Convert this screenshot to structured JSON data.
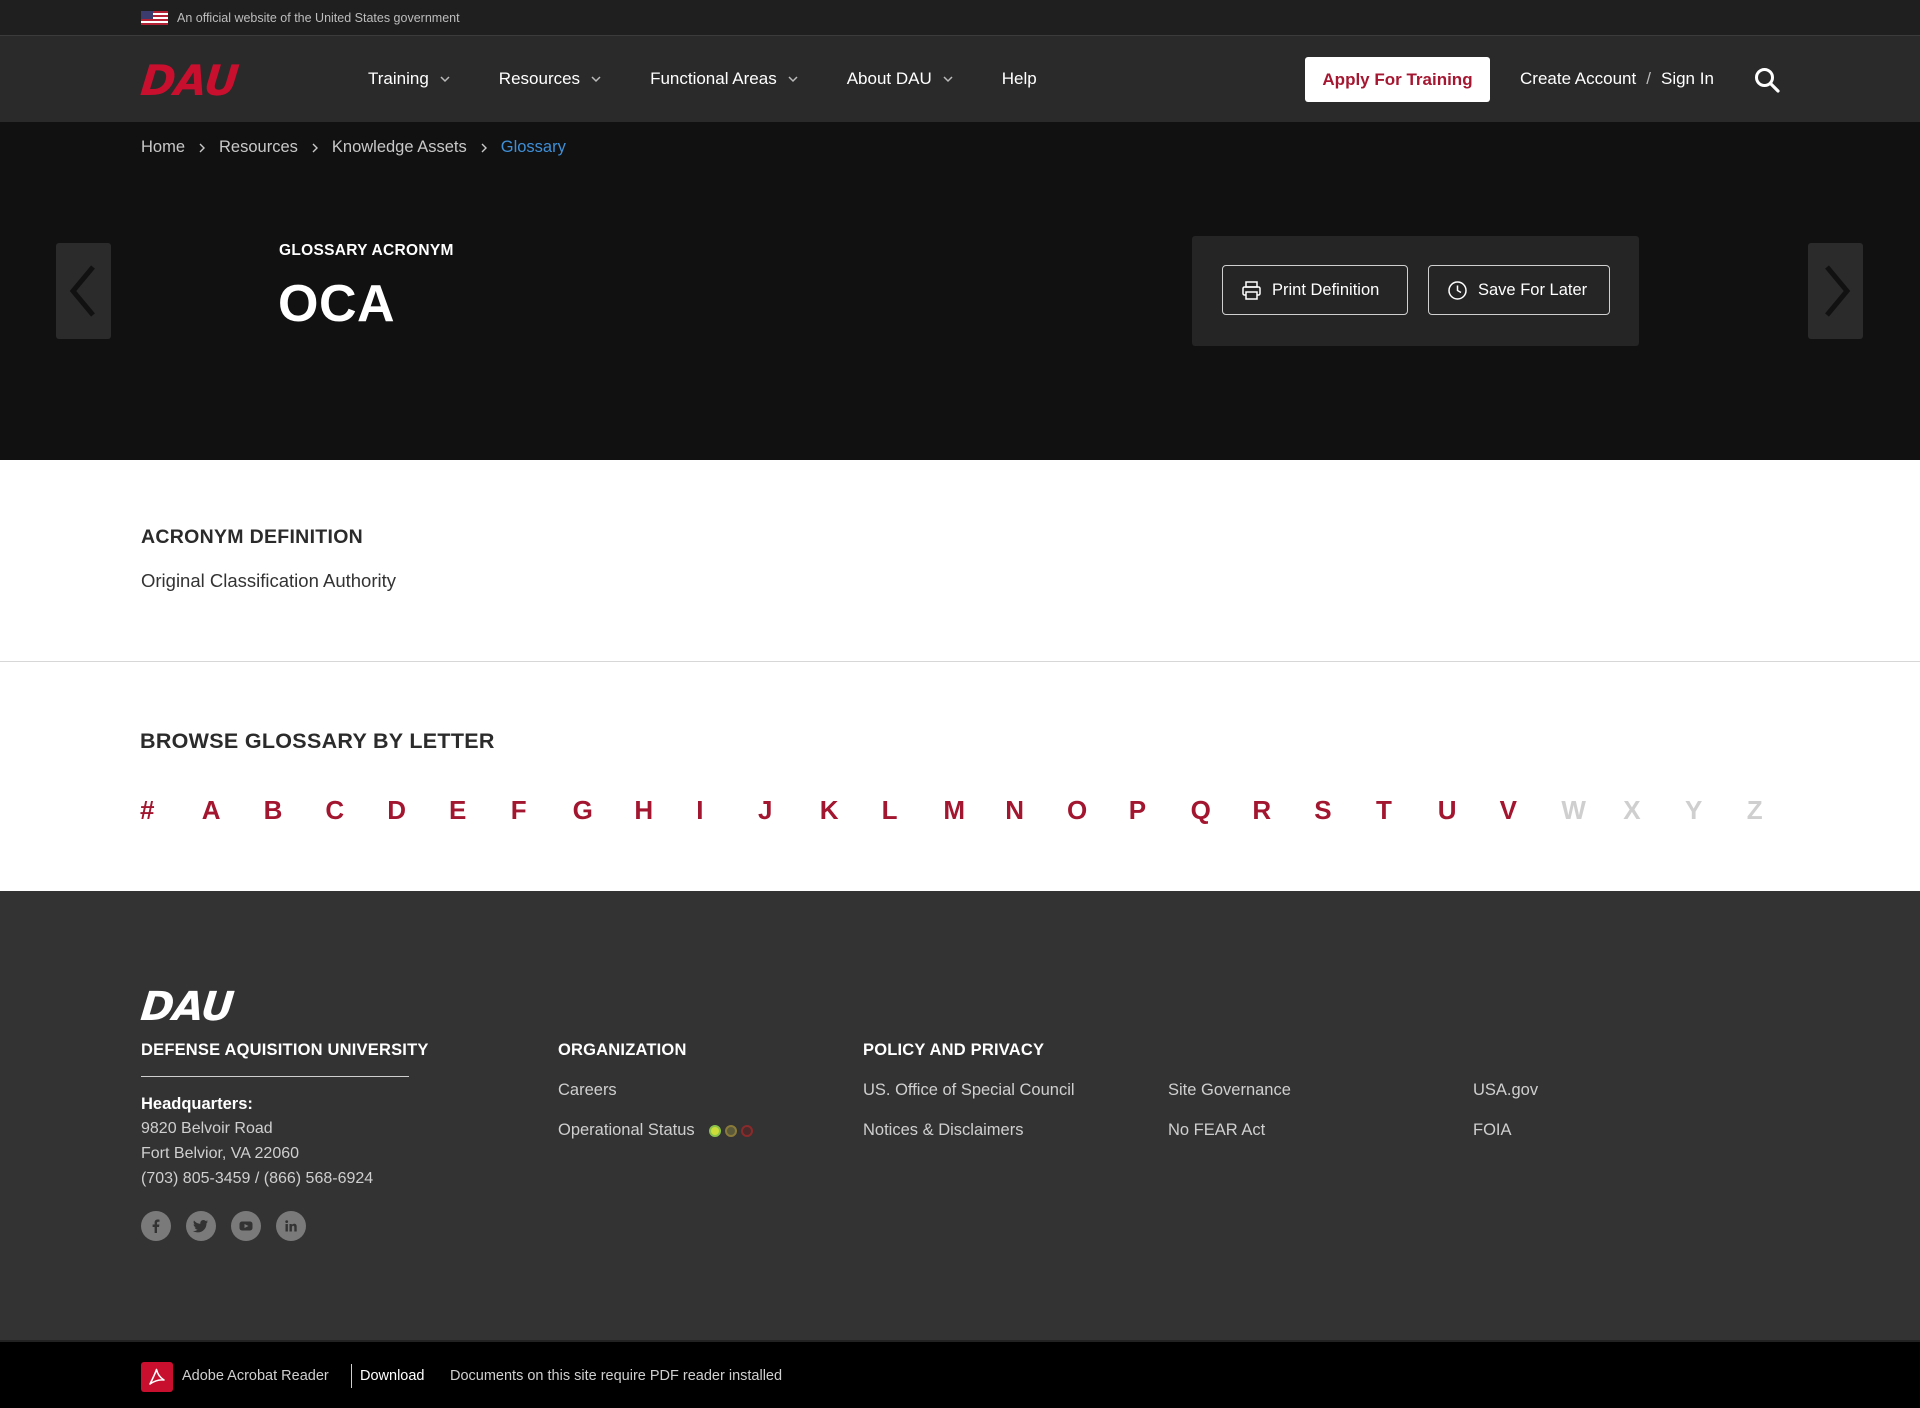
{
  "gov_banner": {
    "text": "An official website of the United States government"
  },
  "header": {
    "logo": "DAU",
    "nav": [
      {
        "label": "Training",
        "dropdown": true
      },
      {
        "label": "Resources",
        "dropdown": true
      },
      {
        "label": "Functional Areas",
        "dropdown": true
      },
      {
        "label": "About DAU",
        "dropdown": true
      },
      {
        "label": "Help",
        "dropdown": false
      }
    ],
    "apply_label": "Apply For Training",
    "create_account_label": "Create Account",
    "separator": "/",
    "sign_in_label": "Sign In"
  },
  "breadcrumb": {
    "items": [
      "Home",
      "Resources",
      "Knowledge Assets"
    ],
    "current": "Glossary"
  },
  "hero": {
    "label": "GLOSSARY ACRONYM",
    "title": "OCA",
    "print_label": "Print Definition",
    "save_label": "Save For Later"
  },
  "definition": {
    "heading": "ACRONYM DEFINITION",
    "text": "Original Classification Authority"
  },
  "browse": {
    "heading": "BROWSE GLOSSARY BY LETTER",
    "letters": [
      {
        "char": "#",
        "enabled": true
      },
      {
        "char": "A",
        "enabled": true
      },
      {
        "char": "B",
        "enabled": true
      },
      {
        "char": "C",
        "enabled": true
      },
      {
        "char": "D",
        "enabled": true
      },
      {
        "char": "E",
        "enabled": true
      },
      {
        "char": "F",
        "enabled": true
      },
      {
        "char": "G",
        "enabled": true
      },
      {
        "char": "H",
        "enabled": true
      },
      {
        "char": "I",
        "enabled": true
      },
      {
        "char": "J",
        "enabled": true
      },
      {
        "char": "K",
        "enabled": true
      },
      {
        "char": "L",
        "enabled": true
      },
      {
        "char": "M",
        "enabled": true
      },
      {
        "char": "N",
        "enabled": true
      },
      {
        "char": "O",
        "enabled": true
      },
      {
        "char": "P",
        "enabled": true
      },
      {
        "char": "Q",
        "enabled": true
      },
      {
        "char": "R",
        "enabled": true
      },
      {
        "char": "S",
        "enabled": true
      },
      {
        "char": "T",
        "enabled": true
      },
      {
        "char": "U",
        "enabled": true
      },
      {
        "char": "V",
        "enabled": true
      },
      {
        "char": "W",
        "enabled": false
      },
      {
        "char": "X",
        "enabled": false
      },
      {
        "char": "Y",
        "enabled": false
      },
      {
        "char": "Z",
        "enabled": false
      }
    ]
  },
  "footer": {
    "logo": "DAU",
    "university": "DEFENSE AQUISITION UNIVERSITY",
    "hq_label": "Headquarters:",
    "address_line1": "9820 Belvoir Road",
    "address_line2": "Fort Belvior, VA 22060",
    "phones": "(703) 805-3459 / (866) 568-6924",
    "socials": [
      "facebook-icon",
      "twitter-icon",
      "youtube-icon",
      "linkedin-icon"
    ],
    "org_heading": "ORGANIZATION",
    "careers": "Careers",
    "operational_status": "Operational Status",
    "status_colors": {
      "green": "#8bc34a",
      "yellow": "#8a7a3a",
      "red": "#8a2a2a"
    },
    "policy_heading": "POLICY AND PRIVACY",
    "policy_links": {
      "osc": "US. Office of Special Council",
      "notices": "Notices & Disclaimers",
      "governance": "Site Governance",
      "nofear": "No FEAR Act",
      "usagov": "USA.gov",
      "foia": "FOIA"
    }
  },
  "bottom_strip": {
    "reader": "Adobe Acrobat Reader",
    "download": "Download",
    "note": "Documents on this site require PDF reader installed"
  },
  "colors": {
    "brand_red": "#a3162f",
    "header_bg": "#2a2a2a",
    "hero_bg": "#111112",
    "footer_bg": "#333333"
  }
}
